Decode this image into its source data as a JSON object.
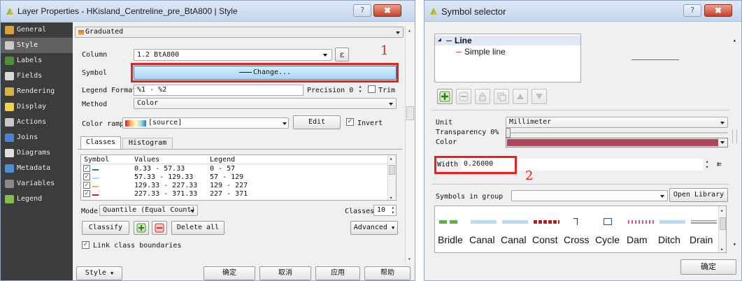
{
  "layer_props": {
    "title": "Layer Properties - HKisland_Centreline_pre_BtA800 | Style",
    "help_btn": "?",
    "close_btn": "✖",
    "sidebar": [
      {
        "label": "General",
        "icon": "wrench-icon",
        "color": "#d9a33a"
      },
      {
        "label": "Style",
        "icon": "brush-icon",
        "color": "#c9c9c9"
      },
      {
        "label": "Labels",
        "icon": "labels-icon",
        "color": "#4e8f3c"
      },
      {
        "label": "Fields",
        "icon": "table-icon",
        "color": "#d8d8d8"
      },
      {
        "label": "Rendering",
        "icon": "paintbrush-icon",
        "color": "#d6b23f"
      },
      {
        "label": "Display",
        "icon": "speech-bubble-icon",
        "color": "#f1d24a"
      },
      {
        "label": "Actions",
        "icon": "gear-icon",
        "color": "#c8c8c8"
      },
      {
        "label": "Joins",
        "icon": "join-icon",
        "color": "#4a84cf"
      },
      {
        "label": "Diagrams",
        "icon": "diagram-icon",
        "color": "#e0e0e0"
      },
      {
        "label": "Metadata",
        "icon": "info-icon",
        "color": "#4a8fd9"
      },
      {
        "label": "Variables",
        "icon": "variables-icon",
        "color": "#8a8a8a"
      },
      {
        "label": "Legend",
        "icon": "legend-icon",
        "color": "#7fbf4f"
      }
    ],
    "renderer": "Graduated",
    "column_label": "Column",
    "column_value": "1.2 BtA800",
    "expr_btn": "ε",
    "symbol_label": "Symbol",
    "change_btn": "Change...",
    "legend_format_label": "Legend Format",
    "legend_format_value": "%1 - %2",
    "precision_label": "Precision 0",
    "trim_label": "Trim",
    "method_label": "Method",
    "method_value": "Color",
    "ramp_label": "Color ramp",
    "ramp_value": "[source]",
    "edit_btn": "Edit",
    "invert_label": "Invert",
    "tabs": [
      "Classes",
      "Histogram"
    ],
    "table_headers": [
      "Symbol",
      "Values",
      "Legend"
    ],
    "classes": [
      {
        "values": "0.33 - 57.33",
        "legend": "0 - 57",
        "color": "#2c7bb6"
      },
      {
        "values": "57.33 - 129.33",
        "legend": "57 - 129",
        "color": "#abd9e9"
      },
      {
        "values": "129.33 - 227.33",
        "legend": "129 - 227",
        "color": "#fdae61"
      },
      {
        "values": "227.33 - 371.33",
        "legend": "227 - 371",
        "color": "#d7191c"
      }
    ],
    "mode_label": "Mode",
    "mode_value": "Quantile (Equal Count)",
    "classes_count_label": "Classes",
    "classes_count": "10",
    "classify_btn": "Classify",
    "delete_all_btn": "Delete all",
    "advanced_btn": "Advanced",
    "link_label": "Link class boundaries",
    "style_btn": "Style",
    "ok_btn": "确定",
    "cancel_btn": "取消",
    "apply_btn": "应用",
    "help_bottom_btn": "帮助",
    "annotation_1": "1"
  },
  "symbol_selector": {
    "title": "Symbol selector",
    "help_btn": "?",
    "close_btn": "✖",
    "tree_root": "Line",
    "tree_child": "Simple line",
    "line_color": "#c6404a",
    "unit_label": "Unit",
    "unit_value": "Millimeter",
    "transparency_label": "Transparency 0%",
    "color_label": "Color",
    "color_value": "#b0445a",
    "width_label": "Width",
    "width_value": "0.26000",
    "annotation_2": "2",
    "symbols_in_group_label": "Symbols in group",
    "open_library_btn": "Open Library",
    "symbols": [
      "Bridle",
      "Canal",
      "Canal",
      "Const",
      "Cross",
      "Cycle",
      "Dam",
      "Ditch",
      "Drain"
    ],
    "ok_btn": "确定"
  }
}
